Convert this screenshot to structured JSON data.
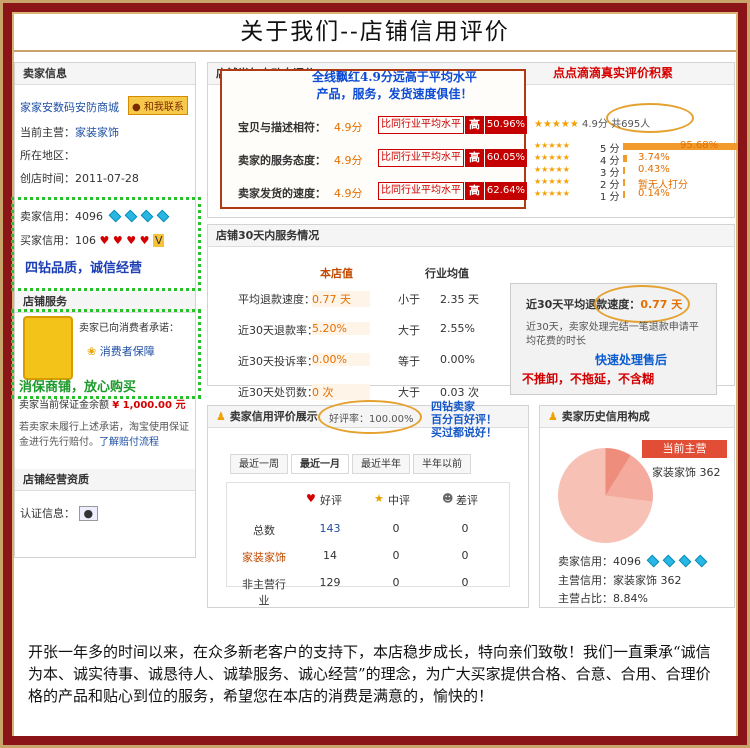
{
  "title": "关于我们--店铺信用评价",
  "left": {
    "seller_info_title": "卖家信息",
    "shop_name": "家家安数码安防商城",
    "contact_badge": "和我联系",
    "current_main_label": "当前主营：",
    "current_main_value": "家装家饰",
    "region_label": "所在地区：",
    "region_value": "",
    "created_label": "创店时间：",
    "created_value": "2011-07-28",
    "seller_credit_label": "卖家信用：",
    "seller_credit_value": "4096",
    "buyer_credit_label": "买家信用：",
    "buyer_credit_value": "106",
    "promo_line": "四钻品质，诚信经营",
    "shop_service_title": "店铺服务",
    "consumer_text": "卖家已向消费者承诺：",
    "consumer_protection": "消费者保障",
    "guarantee_promo": "消保商铺，放心购买",
    "deposit_label": "卖家当前保证金余额",
    "deposit_value": "¥ 1,000.00 元",
    "deposit_note": "若卖家未履行上述承诺，淘宝使用保证金进行先行赔付。",
    "deposit_link": "了解赔付流程",
    "business_qual_title": "店铺经营资质",
    "cert_label": "认证信息："
  },
  "dsr": {
    "title": "店铺半年内动态评分",
    "hand_note": "全线飘红4.9分远高于平均水平\n产品，服务，发货速度俱佳！",
    "items": [
      {
        "label": "宝贝与描述相符：",
        "score": "4.9分",
        "compare": "比同行业平均水平",
        "high": "高",
        "pct": "50.96%"
      },
      {
        "label": "卖家的服务态度：",
        "score": "4.9分",
        "compare": "比同行业平均水平",
        "high": "高",
        "pct": "60.05%"
      },
      {
        "label": "卖家发货的速度：",
        "score": "4.9分",
        "compare": "比同行业平均水平",
        "high": "高",
        "pct": "62.64%"
      }
    ],
    "summary": "4.9分 共695人",
    "real_note": "点点滴滴真实评价积累",
    "dist": [
      {
        "label": "5 分",
        "pct": "95.68%"
      },
      {
        "label": "4 分",
        "pct": "3.74%"
      },
      {
        "label": "3 分",
        "pct": "0.43%"
      },
      {
        "label": "2 分",
        "pct": "暂无人打分"
      },
      {
        "label": "1 分",
        "pct": "0.14%"
      }
    ],
    "dist_bar": [
      0.9568,
      0.0374,
      0.0043,
      0,
      0.0014
    ]
  },
  "service": {
    "title": "店铺30天内服务情况",
    "headers": [
      "本店值",
      "行业均值"
    ],
    "rows": [
      {
        "label": "平均退款速度：",
        "shop": "0.77 天",
        "cmp": "小于",
        "avg": "2.35 天"
      },
      {
        "label": "近30天退款率：",
        "shop": "5.20%",
        "cmp": "大于",
        "avg": "2.55%"
      },
      {
        "label": "近30天投诉率：",
        "shop": "0.00%",
        "cmp": "等于",
        "avg": "0.00%"
      },
      {
        "label": "近30天处罚数：",
        "shop": "0 次",
        "cmp": "大于",
        "avg": "0.03 次"
      }
    ],
    "refund_box": "近30天平均退款速度：",
    "refund_value": "0.77 天",
    "refund_desc": "近30天，卖家处理完结一笔退款申请平均花费的时长",
    "hand_title": "快速处理售后",
    "hand_sub": "不推卸，不拖延，不含糊"
  },
  "credit": {
    "title": "卖家信用评价展示",
    "good_rate": "好评率：100.00%",
    "hand": "四钻卖家\n百分百好评！\n买过都说好！",
    "tabs": [
      "最近一周",
      "最近一月",
      "最近半年",
      "半年以前"
    ],
    "cols": [
      "好评",
      "中评",
      "差评"
    ],
    "rows": [
      {
        "label": "总数",
        "good": "143",
        "mid": "0",
        "bad": "0"
      },
      {
        "label": "家装家饰",
        "good": "14",
        "mid": "0",
        "bad": "0"
      },
      {
        "label": "非主营行业",
        "good": "129",
        "mid": "0",
        "bad": "0"
      }
    ]
  },
  "history": {
    "title": "卖家历史信用构成",
    "legend_title": "当前主营",
    "legend_item": "家装家饰",
    "legend_value": "362",
    "seller_credit": "卖家信用：4096",
    "main_credit": "主营信用：家装家饰 362",
    "main_share": "主营占比：8.84%"
  },
  "footer": "开张一年多的时间以来，在众多新老客户的支持下，本店稳步成长，特向亲们致敬！我们一直秉承“诚信为本、诚实待事、诚恳待人、诚挚服务、诚心经营”的理念，为广大买家提供合格、合意、合用、合理价格的产品和贴心到位的服务，希望您在本店的消费是满意的，愉快的！"
}
